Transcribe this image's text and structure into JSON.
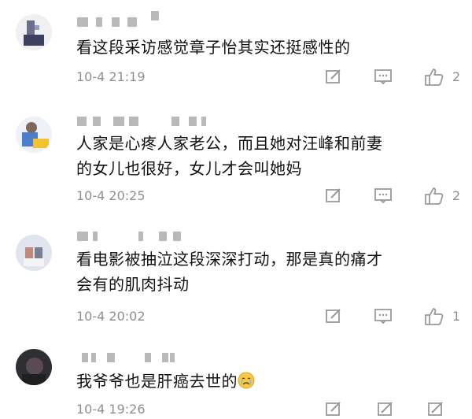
{
  "comments": [
    {
      "text": "看这段采访感觉章子怡其实还挺感性的",
      "time": "10-4 21:19",
      "likes": "2",
      "avatar_color": "#6b6f8a"
    },
    {
      "text_line1": "人家是心疼人家老公，而且她对汪峰和前妻",
      "text_line2": "的女儿也很好，女儿才会叫她妈",
      "time": "10-4 20:25",
      "likes": "2",
      "avatar_color": "#4a7fc9"
    },
    {
      "text_line1": "看电影被抽泣这段深深打动，那是真的痛才",
      "text_line2": "会有的肌肉抖动",
      "time": "10-4 20:02",
      "likes": "1",
      "avatar_color": "#c9ccd6"
    },
    {
      "text": "我爷爷也是肝癌去世的",
      "emoji": "crying-face-icon",
      "time": "10-4 19:26",
      "avatar_color": "#3a3a3a"
    }
  ],
  "icons": {
    "edit": "edit-icon",
    "reply": "comment-bubble-icon",
    "like": "thumbs-up-icon"
  },
  "colors": {
    "text": "#111111",
    "meta": "#8f8f8f",
    "icon": "#9a9a9a"
  }
}
